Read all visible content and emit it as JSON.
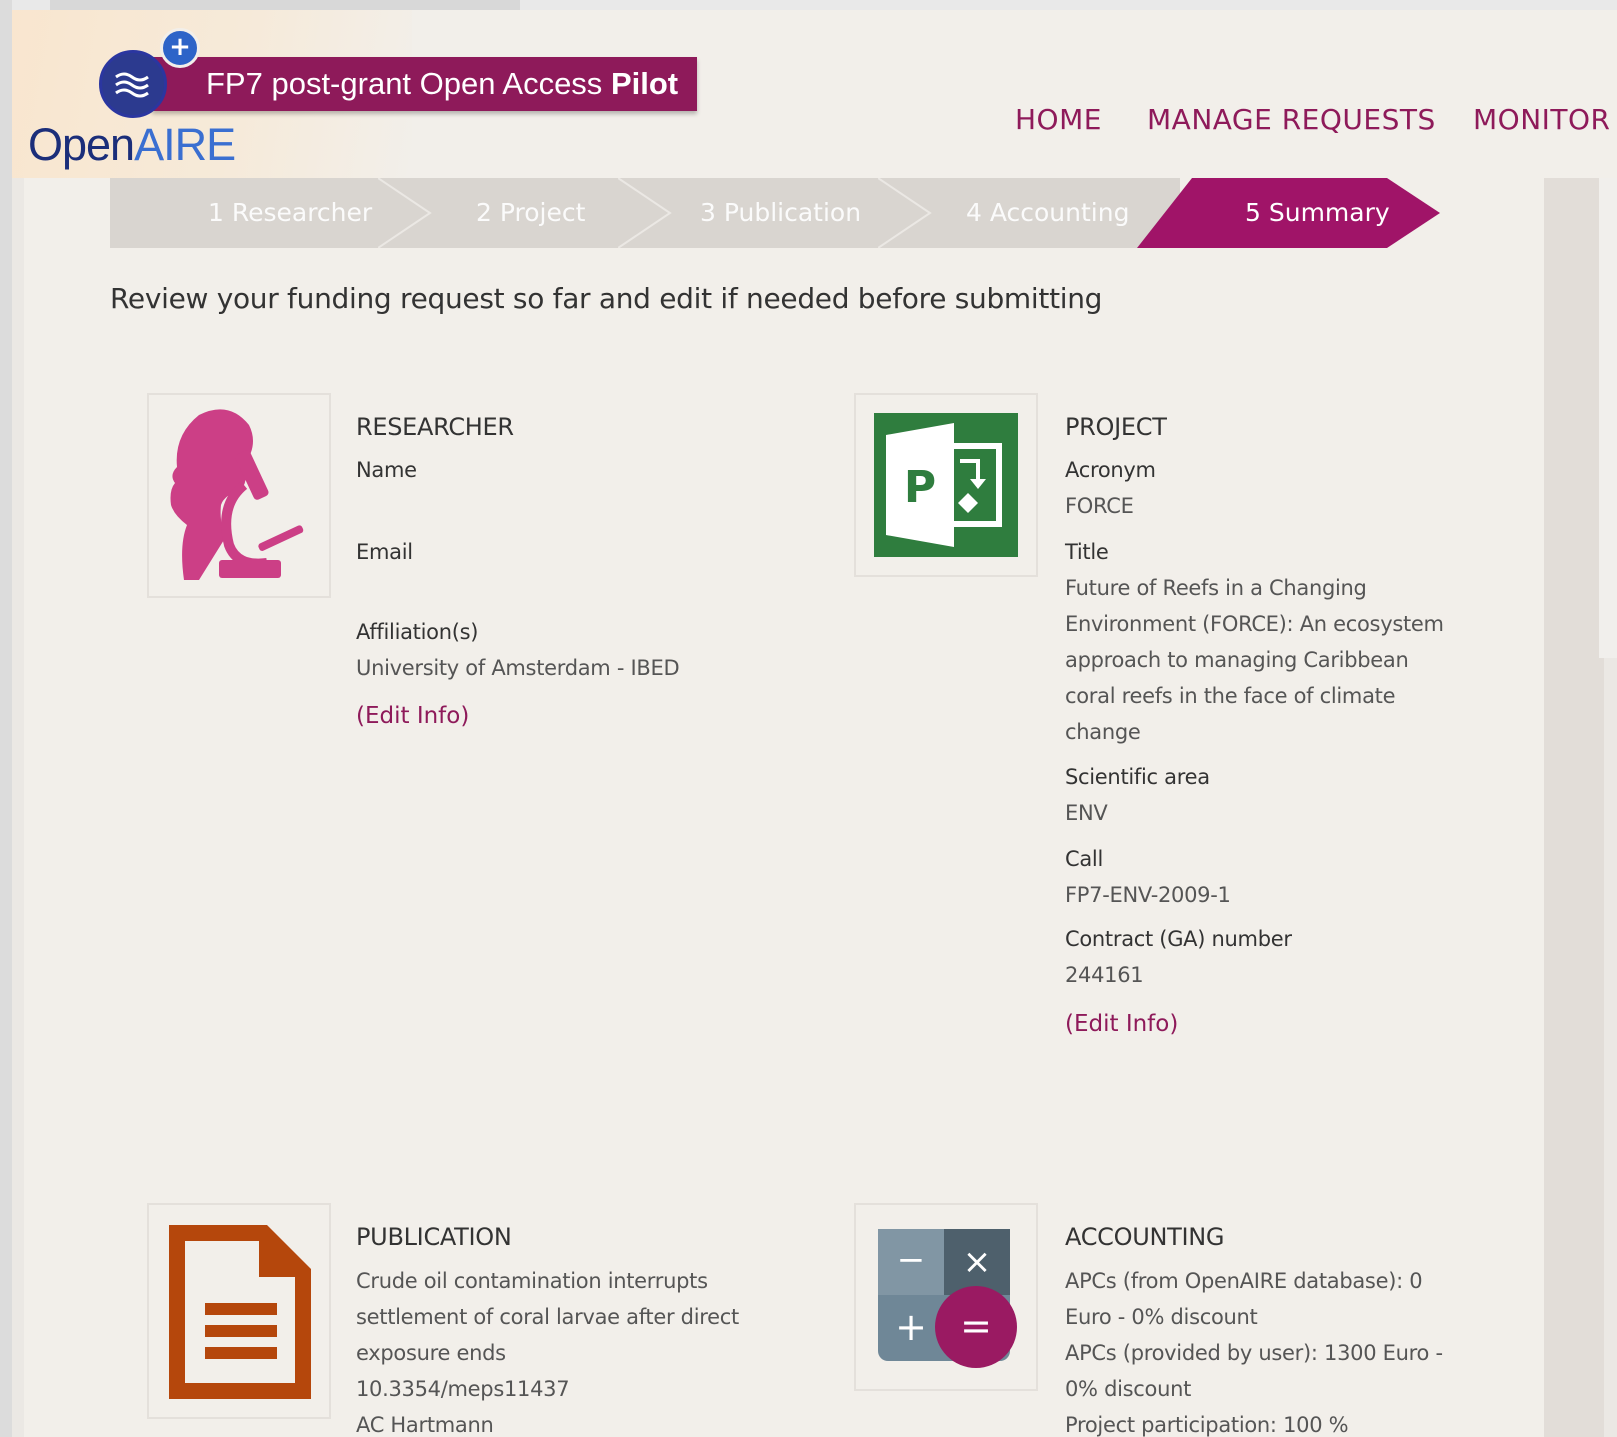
{
  "header": {
    "logo_banner_prefix": "FP7 post-grant Open Access ",
    "logo_banner_bold": "Pilot",
    "logo_plus": "+",
    "logo_open": "Open",
    "logo_aire": "AIRE"
  },
  "nav": {
    "home": "HOME",
    "manage_requests": "MANAGE REQUESTS",
    "monitor": "MONITOR"
  },
  "wizard": {
    "steps": [
      {
        "label": "1 Researcher"
      },
      {
        "label": "2 Project"
      },
      {
        "label": "3 Publication"
      },
      {
        "label": "4 Accounting"
      },
      {
        "label": "5 Summary"
      }
    ],
    "active_index": 4
  },
  "intro": "Review your funding request so far and edit if needed before submitting",
  "researcher": {
    "title": "RESEARCHER",
    "name_label": "Name",
    "email_label": "Email",
    "affiliation_label": "Affiliation(s)",
    "affiliation_value": "University of Amsterdam - IBED",
    "edit": "(Edit Info)"
  },
  "project": {
    "title": "PROJECT",
    "acronym_label": "Acronym",
    "acronym_value": "FORCE",
    "title_label": "Title",
    "title_lines": [
      "Future of Reefs in a Changing",
      "Environment (FORCE): An ecosystem",
      "approach to managing Caribbean",
      "coral reefs in the face of climate",
      "change"
    ],
    "sci_label": "Scientific area",
    "sci_value": "ENV",
    "call_label": "Call",
    "call_value": "FP7-ENV-2009-1",
    "contract_label": "Contract (GA) number",
    "contract_value": "244161",
    "edit": "(Edit Info)"
  },
  "publication": {
    "title": "PUBLICATION",
    "lines": [
      "Crude oil contamination interrupts",
      "settlement of coral larvae after direct",
      "exposure ends",
      "10.3354/meps11437",
      "AC Hartmann"
    ]
  },
  "accounting": {
    "title": "ACCOUNTING",
    "lines": [
      "APCs (from OpenAIRE database): 0",
      "Euro - 0% discount",
      "APCs (provided by user): 1300 Euro -",
      "0% discount",
      "Project participation: 100 %"
    ]
  },
  "icons": {
    "project_letter": "P",
    "calc_minus": "−",
    "calc_times": "×",
    "calc_plus": "+",
    "calc_equals": "=",
    "colors": {
      "brand": "#8e1a5a",
      "researcher_icon": "#cc3f86",
      "project_icon": "#2f7d3e",
      "publication_icon": "#b5470c",
      "calc_grey": "#6f8797",
      "calc_dark": "#4e606c",
      "calc_accent": "#9a1a62"
    }
  }
}
